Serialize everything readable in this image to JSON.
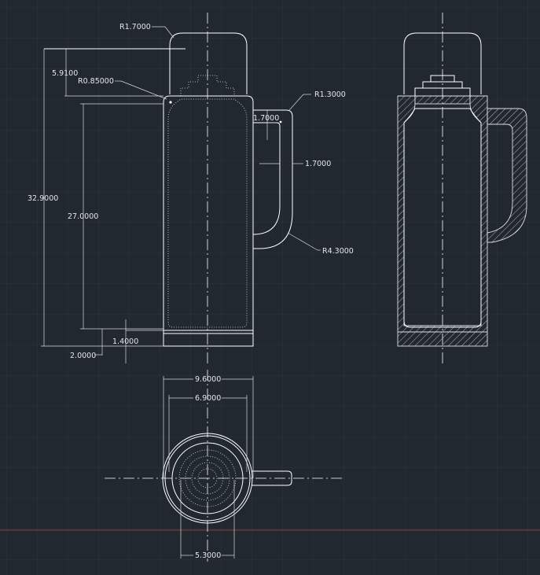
{
  "colors": {
    "background": "#212830",
    "grid": "#2d3541",
    "geometry": "#ffffff",
    "ucs_axis": "#8a3a3a"
  },
  "dimensions": {
    "r_lid": "R1.7000",
    "lid_height": "5.9100",
    "r_shoulder": "R0.85000",
    "r_handle_top": "R1.3000",
    "handle_gap": "1.7000",
    "handle_thickness": "1.7000",
    "overall_height": "32.9000",
    "body_height": "27.0000",
    "r_handle_bottom": "R4.3000",
    "base_step": "1.4000",
    "base_height": "2.0000",
    "outer_diameter": "9.6000",
    "inner_diameter": "6.9000",
    "neck_diameter": "5.3000"
  }
}
